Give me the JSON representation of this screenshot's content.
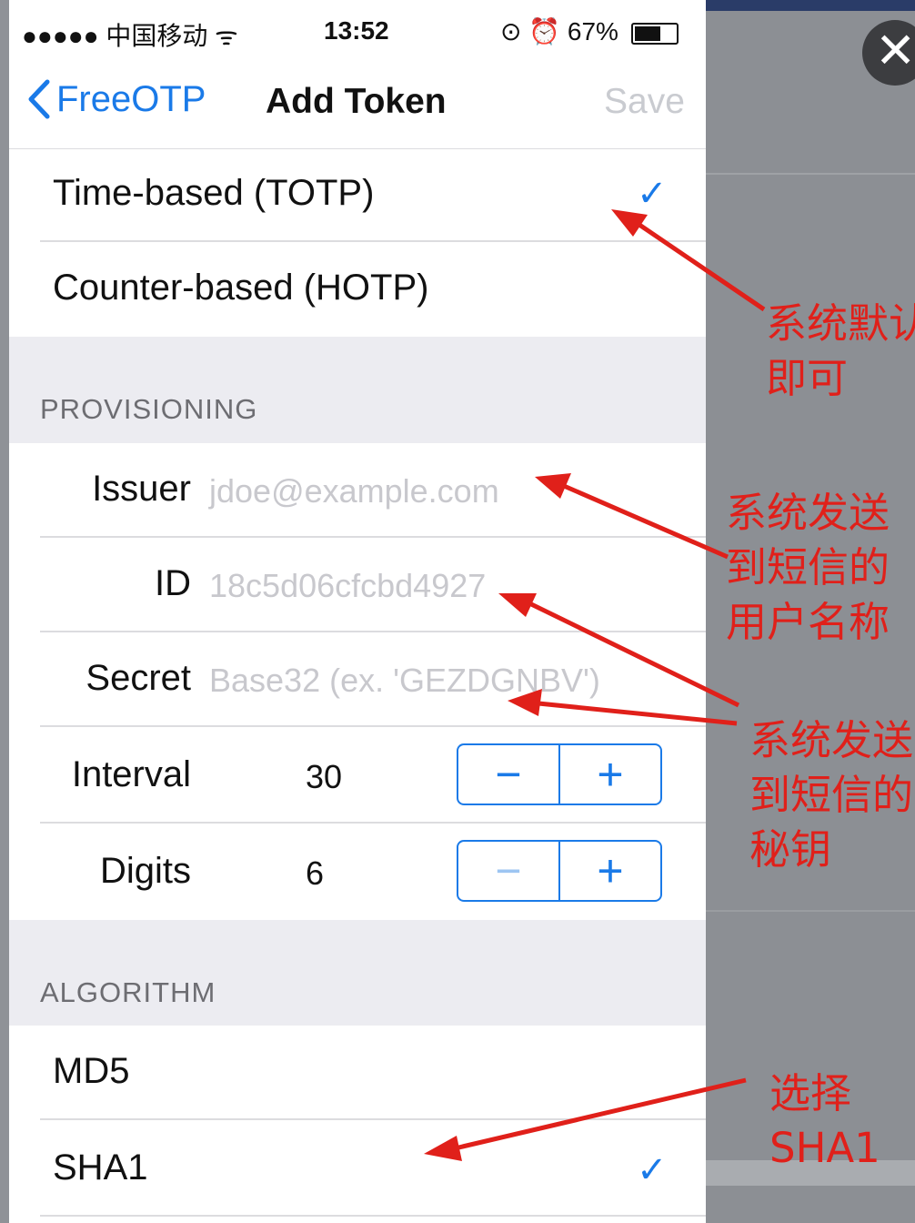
{
  "status_bar": {
    "carrier": "●●●●● 中国移动 ᯤ",
    "time": "13:52",
    "battery_label": "⊙ ⏰ 67%"
  },
  "nav": {
    "back_label": "FreeOTP",
    "title": "Add Token",
    "save_label": "Save"
  },
  "type_options": [
    {
      "label": "Time-based (TOTP)",
      "checked": true
    },
    {
      "label": "Counter-based (HOTP)",
      "checked": false
    }
  ],
  "provisioning": {
    "header": "PROVISIONING",
    "issuer": {
      "label": "Issuer",
      "placeholder": "jdoe@example.com"
    },
    "id": {
      "label": "ID",
      "placeholder": "18c5d06cfcbd4927"
    },
    "secret": {
      "label": "Secret",
      "placeholder": "Base32 (ex. 'GEZDGNBV')"
    },
    "interval": {
      "label": "Interval",
      "value": "30"
    },
    "digits": {
      "label": "Digits",
      "value": "6"
    }
  },
  "algorithm": {
    "header": "ALGORITHM",
    "options": [
      {
        "label": "MD5",
        "checked": false
      },
      {
        "label": "SHA1",
        "checked": true
      }
    ]
  },
  "stepper": {
    "minus": "−",
    "plus": "+"
  },
  "check_glyph": "✓",
  "close_glyph": "✕",
  "annotations": [
    "系统默认\n即可",
    "系统发送\n到短信的\n用户名称",
    "系统发送\n到短信的\n秘钥",
    "选择\nSHA1"
  ],
  "colors": {
    "accent": "#1a7ae8",
    "annotation": "#e0201a",
    "section_bg": "#ececf1"
  }
}
